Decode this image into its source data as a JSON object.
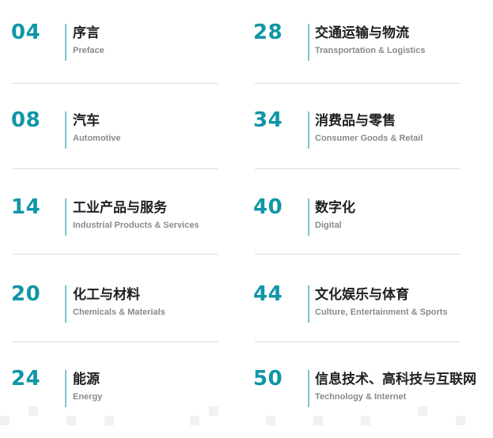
{
  "toc": {
    "left": [
      {
        "page": "04",
        "title_zh": "序言",
        "title_en": "Preface"
      },
      {
        "page": "08",
        "title_zh": "汽车",
        "title_en": "Automotive"
      },
      {
        "page": "14",
        "title_zh": "工业产品与服务",
        "title_en": "Industrial Products & Services"
      },
      {
        "page": "20",
        "title_zh": "化工与材料",
        "title_en": "Chemicals & Materials"
      },
      {
        "page": "24",
        "title_zh": "能源",
        "title_en": "Energy"
      }
    ],
    "right": [
      {
        "page": "28",
        "title_zh": "交通运输与物流",
        "title_en": "Transportation & Logistics"
      },
      {
        "page": "34",
        "title_zh": "消费品与零售",
        "title_en": "Consumer Goods & Retail"
      },
      {
        "page": "40",
        "title_zh": "数字化",
        "title_en": "Digital"
      },
      {
        "page": "44",
        "title_zh": "文化娱乐与体育",
        "title_en": "Culture, Entertainment & Sports"
      },
      {
        "page": "50",
        "title_zh": "信息技术、高科技与互联网",
        "title_en": "Technology & Internet"
      }
    ]
  },
  "colors": {
    "accent": "#1096a6",
    "bar": "#7fc3cc",
    "title": "#1f1f1f",
    "subtitle": "#8a8a8a",
    "divider": "#dcdcdc"
  }
}
